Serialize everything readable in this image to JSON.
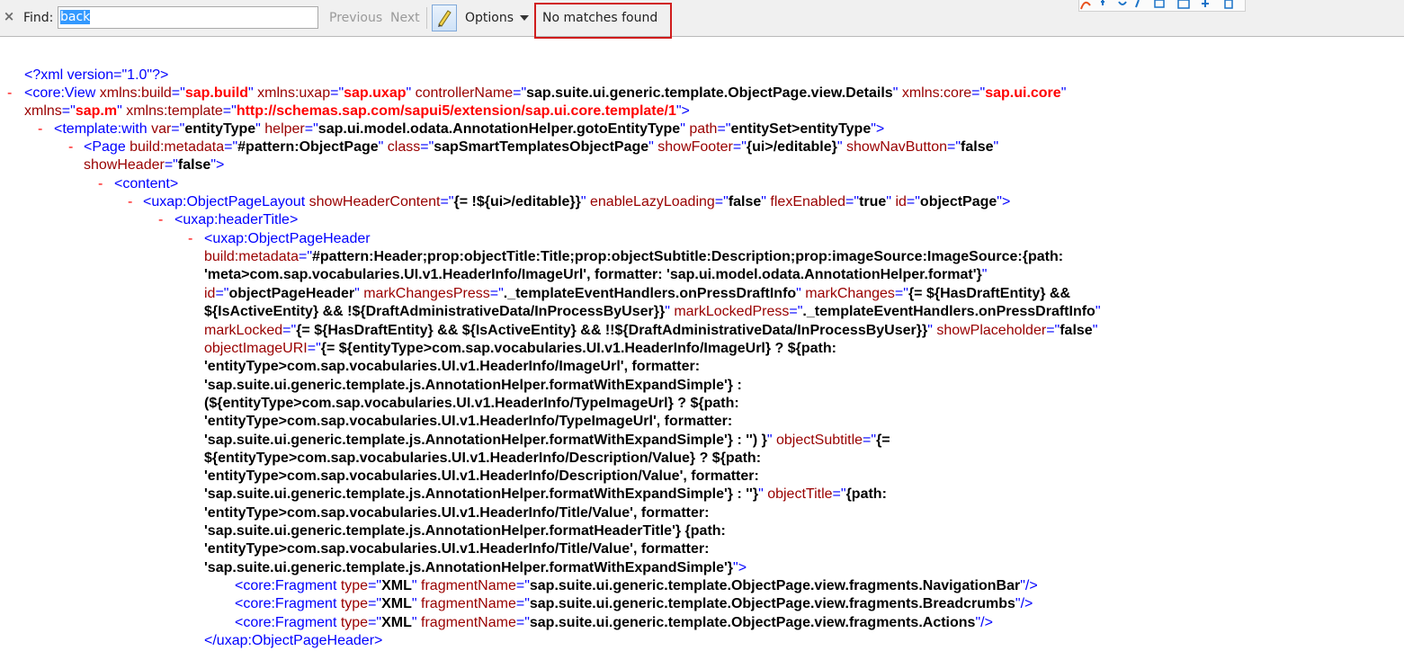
{
  "findbar": {
    "close_glyph": "×",
    "find_label": "Find:",
    "search_value": "back",
    "previous_label": "Previous",
    "next_label": "Next",
    "options_label": "Options",
    "status_text": "No matches found"
  },
  "colors": {
    "tag": "#0000ff",
    "attribute_name": "#990000",
    "attribute_value": "#000000",
    "namespace_value": "#ff0000",
    "collapse_toggle": "#ff0000",
    "highlight_box": "#d01c1c",
    "selection": "#3399ff"
  },
  "icons": {
    "close": "close-icon",
    "highlight": "highlighter-pen-icon",
    "options_dropdown": "chevron-down-icon",
    "collapse": "minus-toggle-icon"
  },
  "xml": {
    "toggle_glyph": "-",
    "lines": [
      {
        "t": false,
        "segs": [
          [
            "t",
            "<?xml version=\"1.0\"?>"
          ]
        ]
      },
      {
        "t": true,
        "segs": [
          [
            "t",
            "<core:View "
          ],
          [
            "an",
            "xmlns:build"
          ],
          [
            "t",
            "=\""
          ],
          [
            "ns",
            "sap.build"
          ],
          [
            "t",
            "\" "
          ],
          [
            "an",
            "xmlns:uxap"
          ],
          [
            "t",
            "=\""
          ],
          [
            "ns",
            "sap.uxap"
          ],
          [
            "t",
            "\" "
          ],
          [
            "an",
            "controllerName"
          ],
          [
            "t",
            "=\""
          ],
          [
            "av",
            "sap.suite.ui.generic.template.ObjectPage.view.Details"
          ],
          [
            "t",
            "\" "
          ],
          [
            "an",
            "xmlns:core"
          ],
          [
            "t",
            "=\""
          ],
          [
            "ns",
            "sap.ui.core"
          ],
          [
            "t",
            "\""
          ]
        ]
      },
      {
        "t": false,
        "segs": [
          [
            "an",
            "xmlns"
          ],
          [
            "t",
            "=\""
          ],
          [
            "ns",
            "sap.m"
          ],
          [
            "t",
            "\" "
          ],
          [
            "an",
            "xmlns:template"
          ],
          [
            "t",
            "=\""
          ],
          [
            "ns",
            "http://schemas.sap.com/sapui5/extension/sap.ui.core.template/1"
          ],
          [
            "t",
            "\">"
          ]
        ]
      },
      {
        "t": true,
        "segs": [
          [
            "t",
            "<template:with "
          ],
          [
            "an",
            "var"
          ],
          [
            "t",
            "=\""
          ],
          [
            "av",
            "entityType"
          ],
          [
            "t",
            "\" "
          ],
          [
            "an",
            "helper"
          ],
          [
            "t",
            "=\""
          ],
          [
            "av",
            "sap.ui.model.odata.AnnotationHelper.gotoEntityType"
          ],
          [
            "t",
            "\" "
          ],
          [
            "an",
            "path"
          ],
          [
            "t",
            "=\""
          ],
          [
            "av",
            "entitySet>entityType"
          ],
          [
            "t",
            "\">"
          ]
        ]
      },
      {
        "t": true,
        "segs": [
          [
            "t",
            "<Page "
          ],
          [
            "an",
            "build:metadata"
          ],
          [
            "t",
            "=\""
          ],
          [
            "av",
            "#pattern:ObjectPage"
          ],
          [
            "t",
            "\" "
          ],
          [
            "an",
            "class"
          ],
          [
            "t",
            "=\""
          ],
          [
            "av",
            "sapSmartTemplatesObjectPage"
          ],
          [
            "t",
            "\" "
          ],
          [
            "an",
            "showFooter"
          ],
          [
            "t",
            "=\""
          ],
          [
            "av",
            "{ui>/editable}"
          ],
          [
            "t",
            "\" "
          ],
          [
            "an",
            "showNavButton"
          ],
          [
            "t",
            "=\""
          ],
          [
            "av",
            "false"
          ],
          [
            "t",
            "\""
          ]
        ]
      },
      {
        "t": false,
        "segs": [
          [
            "an",
            "showHeader"
          ],
          [
            "t",
            "=\""
          ],
          [
            "av",
            "false"
          ],
          [
            "t",
            "\">"
          ]
        ]
      },
      {
        "t": true,
        "segs": [
          [
            "t",
            "<content>"
          ]
        ]
      },
      {
        "t": true,
        "segs": [
          [
            "t",
            "<uxap:ObjectPageLayout "
          ],
          [
            "an",
            "showHeaderContent"
          ],
          [
            "t",
            "=\""
          ],
          [
            "av",
            "{= !${ui>/editable}}"
          ],
          [
            "t",
            "\" "
          ],
          [
            "an",
            "enableLazyLoading"
          ],
          [
            "t",
            "=\""
          ],
          [
            "av",
            "false"
          ],
          [
            "t",
            "\" "
          ],
          [
            "an",
            "flexEnabled"
          ],
          [
            "t",
            "=\""
          ],
          [
            "av",
            "true"
          ],
          [
            "t",
            "\" "
          ],
          [
            "an",
            "id"
          ],
          [
            "t",
            "=\""
          ],
          [
            "av",
            "objectPage"
          ],
          [
            "t",
            "\">"
          ]
        ]
      },
      {
        "t": true,
        "segs": [
          [
            "t",
            "<uxap:headerTitle>"
          ]
        ]
      },
      {
        "t": true,
        "segs": [
          [
            "t",
            "<uxap:ObjectPageHeader"
          ]
        ]
      },
      {
        "t": false,
        "segs": [
          [
            "an",
            "build:metadata"
          ],
          [
            "t",
            "=\""
          ],
          [
            "av",
            "#pattern:Header;prop:objectTitle:Title;prop:objectSubtitle:Description;prop:imageSource:ImageSource:{path:"
          ]
        ]
      },
      {
        "t": false,
        "segs": [
          [
            "av",
            "'meta>com.sap.vocabularies.UI.v1.HeaderInfo/ImageUrl', formatter: 'sap.ui.model.odata.AnnotationHelper.format'}"
          ],
          [
            "t",
            "\""
          ]
        ]
      },
      {
        "t": false,
        "segs": [
          [
            "an",
            "id"
          ],
          [
            "t",
            "=\""
          ],
          [
            "av",
            "objectPageHeader"
          ],
          [
            "t",
            "\" "
          ],
          [
            "an",
            "markChangesPress"
          ],
          [
            "t",
            "=\""
          ],
          [
            "av",
            "._templateEventHandlers.onPressDraftInfo"
          ],
          [
            "t",
            "\" "
          ],
          [
            "an",
            "markChanges"
          ],
          [
            "t",
            "=\""
          ],
          [
            "av",
            "{= ${HasDraftEntity} &&"
          ]
        ]
      },
      {
        "t": false,
        "segs": [
          [
            "av",
            "${IsActiveEntity} && !${DraftAdministrativeData/InProcessByUser}}"
          ],
          [
            "t",
            "\" "
          ],
          [
            "an",
            "markLockedPress"
          ],
          [
            "t",
            "=\""
          ],
          [
            "av",
            "._templateEventHandlers.onPressDraftInfo"
          ],
          [
            "t",
            "\""
          ]
        ]
      },
      {
        "t": false,
        "segs": [
          [
            "an",
            "markLocked"
          ],
          [
            "t",
            "=\""
          ],
          [
            "av",
            "{= ${HasDraftEntity} && ${IsActiveEntity} && !!${DraftAdministrativeData/InProcessByUser}}"
          ],
          [
            "t",
            "\" "
          ],
          [
            "an",
            "showPlaceholder"
          ],
          [
            "t",
            "=\""
          ],
          [
            "av",
            "false"
          ],
          [
            "t",
            "\""
          ]
        ]
      },
      {
        "t": false,
        "segs": [
          [
            "an",
            "objectImageURI"
          ],
          [
            "t",
            "=\""
          ],
          [
            "av",
            "{= ${entityType>com.sap.vocabularies.UI.v1.HeaderInfo/ImageUrl} ? ${path:"
          ]
        ]
      },
      {
        "t": false,
        "segs": [
          [
            "av",
            "'entityType>com.sap.vocabularies.UI.v1.HeaderInfo/ImageUrl', formatter:"
          ]
        ]
      },
      {
        "t": false,
        "segs": [
          [
            "av",
            "'sap.suite.ui.generic.template.js.AnnotationHelper.formatWithExpandSimple'} :"
          ]
        ]
      },
      {
        "t": false,
        "segs": [
          [
            "av",
            "(${entityType>com.sap.vocabularies.UI.v1.HeaderInfo/TypeImageUrl} ? ${path:"
          ]
        ]
      },
      {
        "t": false,
        "segs": [
          [
            "av",
            "'entityType>com.sap.vocabularies.UI.v1.HeaderInfo/TypeImageUrl', formatter:"
          ]
        ]
      },
      {
        "t": false,
        "segs": [
          [
            "av",
            "'sap.suite.ui.generic.template.js.AnnotationHelper.formatWithExpandSimple'} : '') }"
          ],
          [
            "t",
            "\" "
          ],
          [
            "an",
            "objectSubtitle"
          ],
          [
            "t",
            "=\""
          ],
          [
            "av",
            "{="
          ]
        ]
      },
      {
        "t": false,
        "segs": [
          [
            "av",
            "${entityType>com.sap.vocabularies.UI.v1.HeaderInfo/Description/Value} ? ${path:"
          ]
        ]
      },
      {
        "t": false,
        "segs": [
          [
            "av",
            "'entityType>com.sap.vocabularies.UI.v1.HeaderInfo/Description/Value', formatter:"
          ]
        ]
      },
      {
        "t": false,
        "segs": [
          [
            "av",
            "'sap.suite.ui.generic.template.js.AnnotationHelper.formatWithExpandSimple'} : ''}"
          ],
          [
            "t",
            "\" "
          ],
          [
            "an",
            "objectTitle"
          ],
          [
            "t",
            "=\""
          ],
          [
            "av",
            "{path:"
          ]
        ]
      },
      {
        "t": false,
        "segs": [
          [
            "av",
            "'entityType>com.sap.vocabularies.UI.v1.HeaderInfo/Title/Value', formatter:"
          ]
        ]
      },
      {
        "t": false,
        "segs": [
          [
            "av",
            "'sap.suite.ui.generic.template.js.AnnotationHelper.formatHeaderTitle'} {path:"
          ]
        ]
      },
      {
        "t": false,
        "segs": [
          [
            "av",
            "'entityType>com.sap.vocabularies.UI.v1.HeaderInfo/Title/Value', formatter:"
          ]
        ]
      },
      {
        "t": false,
        "segs": [
          [
            "av",
            "'sap.suite.ui.generic.template.js.AnnotationHelper.formatWithExpandSimple'}"
          ],
          [
            "t",
            "\">"
          ]
        ]
      },
      {
        "t": false,
        "segs": [
          [
            "t",
            "<core:Fragment "
          ],
          [
            "an",
            "type"
          ],
          [
            "t",
            "=\""
          ],
          [
            "av",
            "XML"
          ],
          [
            "t",
            "\" "
          ],
          [
            "an",
            "fragmentName"
          ],
          [
            "t",
            "=\""
          ],
          [
            "av",
            "sap.suite.ui.generic.template.ObjectPage.view.fragments.NavigationBar"
          ],
          [
            "t",
            "\"/>"
          ]
        ]
      },
      {
        "t": false,
        "segs": [
          [
            "t",
            "<core:Fragment "
          ],
          [
            "an",
            "type"
          ],
          [
            "t",
            "=\""
          ],
          [
            "av",
            "XML"
          ],
          [
            "t",
            "\" "
          ],
          [
            "an",
            "fragmentName"
          ],
          [
            "t",
            "=\""
          ],
          [
            "av",
            "sap.suite.ui.generic.template.ObjectPage.view.fragments.Breadcrumbs"
          ],
          [
            "t",
            "\"/>"
          ]
        ]
      },
      {
        "t": false,
        "segs": [
          [
            "t",
            "<core:Fragment "
          ],
          [
            "an",
            "type"
          ],
          [
            "t",
            "=\""
          ],
          [
            "av",
            "XML"
          ],
          [
            "t",
            "\" "
          ],
          [
            "an",
            "fragmentName"
          ],
          [
            "t",
            "=\""
          ],
          [
            "av",
            "sap.suite.ui.generic.template.ObjectPage.view.fragments.Actions"
          ],
          [
            "t",
            "\"/>"
          ]
        ]
      },
      {
        "t": false,
        "segs": [
          [
            "t",
            "</uxap:ObjectPageHeader>"
          ]
        ]
      }
    ]
  }
}
